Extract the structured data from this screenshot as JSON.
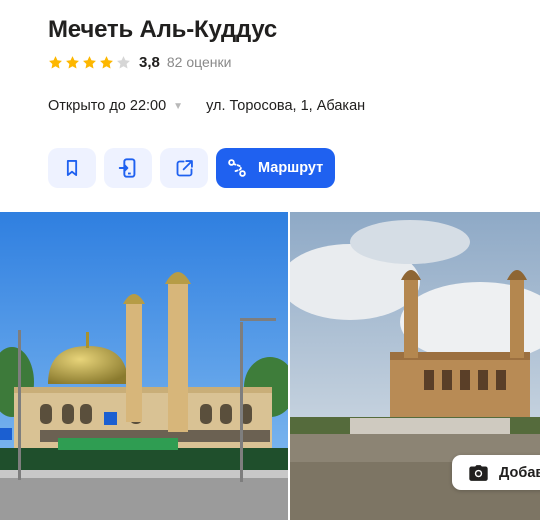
{
  "place": {
    "name": "Мечеть Аль-Куддус",
    "rating": {
      "value": "3,8",
      "stars_filled": 4,
      "stars_total": 5,
      "count_text": "82 оценки"
    },
    "hours": "Открыто до 22:00",
    "address": "ул. Торосова, 1, Абакан"
  },
  "actions": {
    "bookmark_icon": "bookmark-icon",
    "phone_icon": "phone-send-icon",
    "share_icon": "share-icon",
    "route_icon": "route-icon",
    "route_label": "Маршрут"
  },
  "photos": {
    "add_label": "Добав"
  },
  "colors": {
    "accent": "#1f61f0",
    "button_bg": "#eef2ff",
    "star": "#fdb700",
    "star_empty": "#d6d6d6",
    "muted": "#898989"
  }
}
